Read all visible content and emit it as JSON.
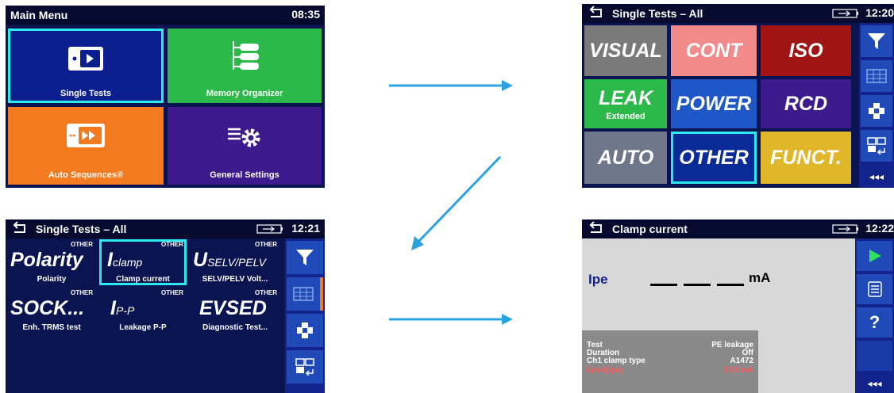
{
  "screen1": {
    "title": "Main Menu",
    "time": "08:35",
    "tiles": [
      {
        "label": "Single Tests"
      },
      {
        "label": "Memory Organizer"
      },
      {
        "label": "Auto Sequences®"
      },
      {
        "label": "General Settings"
      }
    ]
  },
  "screen2": {
    "title": "Single Tests – All",
    "time": "12:20",
    "grid": [
      {
        "label": "VISUAL",
        "color": "#7a7a7a"
      },
      {
        "label": "CONT",
        "color": "#f28b8b"
      },
      {
        "label": "ISO",
        "color": "#a01616"
      },
      {
        "label": "LEAK",
        "sub": "Extended",
        "color": "#2db84a"
      },
      {
        "label": "POWER",
        "color": "#1f57c6"
      },
      {
        "label": "RCD",
        "color": "#3d1b8c"
      },
      {
        "label": "AUTO",
        "color": "#70778a"
      },
      {
        "label": "OTHER",
        "color": "#0a2a96"
      },
      {
        "label": "FUNCT.",
        "color": "#e0b72a"
      }
    ],
    "sidebar_more": "◂◂◂"
  },
  "screen3": {
    "title": "Single Tests – All",
    "time": "12:21",
    "tiles": [
      {
        "cat": "OTHER",
        "big": "Polarity",
        "sub": "",
        "name": "Polarity"
      },
      {
        "cat": "OTHER",
        "big": "I",
        "sub": "clamp",
        "name": "Clamp current"
      },
      {
        "cat": "OTHER",
        "big": "U",
        "sub": "SELV/PELV",
        "name": "SELV/PELV Volt..."
      },
      {
        "cat": "OTHER",
        "big": "SOCK...",
        "sub": "",
        "name": "Enh. TRMS test"
      },
      {
        "cat": "OTHER",
        "big": "I",
        "sub": "P-P",
        "name": "Leakage P-P"
      },
      {
        "cat": "OTHER",
        "big": "EVSED",
        "sub": "",
        "name": "Diagnostic Test..."
      }
    ],
    "sidebar_more": "◂◂◂"
  },
  "screen4": {
    "title": "Clamp current",
    "time": "12:22",
    "result_label": "Ipe",
    "result_value": "___",
    "result_unit": "mA",
    "params": [
      {
        "key": "Test",
        "value": "PE leakage"
      },
      {
        "key": "Duration",
        "value": "Off"
      },
      {
        "key": "Ch1 clamp type",
        "value": "A1472"
      },
      {
        "key": "Limit(Ipe)",
        "value": "3.50 mA"
      }
    ],
    "sidebar_help": "?",
    "sidebar_more": "◂◂◂"
  },
  "colors": {
    "arrow": "#2ba3e0",
    "selection": "#2ee8f0",
    "sidebar": "#12238c",
    "sidebar_button": "#1f4ab8"
  }
}
